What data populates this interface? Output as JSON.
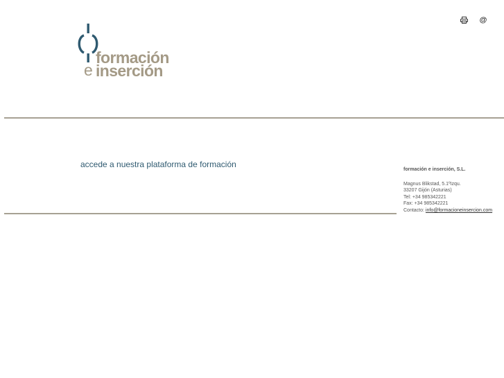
{
  "header": {
    "print_icon": "printer-icon",
    "email_icon_glyph": "@",
    "email_icon": "at-icon"
  },
  "logo": {
    "word1": "formación",
    "letter_e": "e",
    "word2": "inserción",
    "colors": {
      "mark": "#2f5a70",
      "text": "#a49a86"
    }
  },
  "main": {
    "platform_link": "accede a nuestra plataforma de formación"
  },
  "contact": {
    "company": "formación e inserción, S.L.",
    "address1": "Magnus Blikstad, 5.1ºIzqu.",
    "address2": "33207 Gijón (Asturias)",
    "tel": "Tel: +34 985342221",
    "fax": "Fax: +34 985342221",
    "contact_label": "Contacto: ",
    "email": "info@formacioneinsercion.com"
  },
  "colors": {
    "rule": "#a7a193",
    "link": "#2f5a70"
  }
}
